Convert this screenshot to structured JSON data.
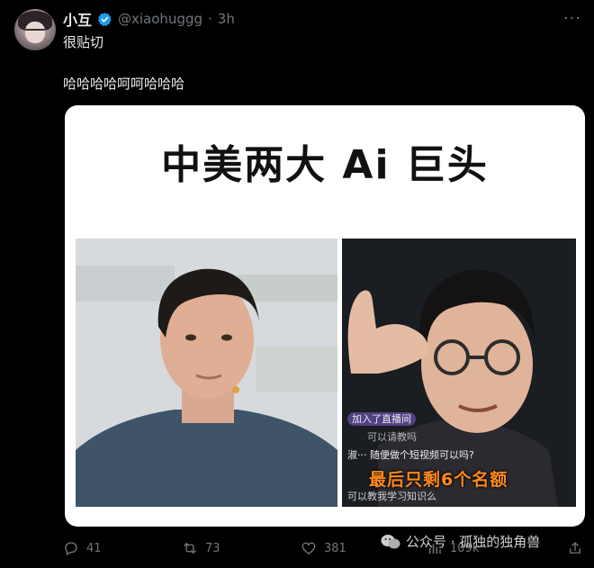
{
  "tweet": {
    "author_name": "小互",
    "handle": "@xiaohuggg",
    "separator": "·",
    "time": "3h",
    "more": "···",
    "line1": "很贴切",
    "line2": "哈哈哈哈呵呵哈哈哈"
  },
  "media": {
    "title": "中美两大 Ai 巨头",
    "right_overlay": {
      "join_line": "加入了直播间",
      "msg1": "可以请教吗",
      "msg2_user": "淑···",
      "msg2": "随便做个短视频可以吗?",
      "msg3": "可以教我学习知识么",
      "caption": "最后只剩6个名额"
    }
  },
  "actions": {
    "replies": "41",
    "retweets": "73",
    "likes": "381",
    "views": "109k"
  },
  "watermark": {
    "text": "公众号 · 孤独的独角兽"
  },
  "colors": {
    "background": "#000000",
    "text": "#e7e9ea",
    "muted": "#71767b",
    "verified": "#1d9bf0",
    "caption": "#ff8a1d"
  }
}
